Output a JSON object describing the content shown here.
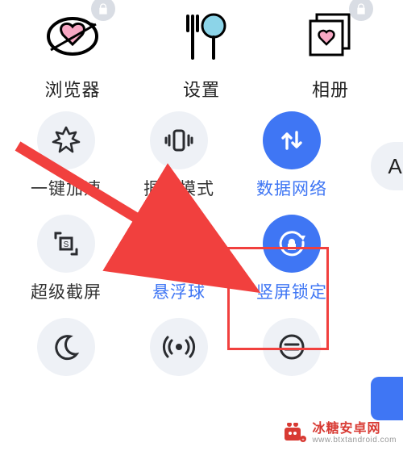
{
  "apps": [
    {
      "id": "browser",
      "label": "浏览器",
      "locked": true
    },
    {
      "id": "settings",
      "label": "设置",
      "locked": false
    },
    {
      "id": "gallery",
      "label": "相册",
      "locked": true
    }
  ],
  "quick_settings": [
    {
      "id": "boost",
      "label": "一键加速",
      "state": "off"
    },
    {
      "id": "vibrate",
      "label": "振动模式",
      "state": "off"
    },
    {
      "id": "data",
      "label": "数据网络",
      "state": "on"
    },
    {
      "id": "screenshot",
      "label": "超级截屏",
      "state": "off"
    },
    {
      "id": "floatball",
      "label": "悬浮球",
      "state": "on"
    },
    {
      "id": "rotationlock",
      "label": "竖屏锁定",
      "state": "on"
    },
    {
      "id": "nightmode",
      "label": "",
      "state": "off"
    },
    {
      "id": "hotspot",
      "label": "",
      "state": "off"
    },
    {
      "id": "more",
      "label": "",
      "state": "off"
    }
  ],
  "highlight_target": "rotationlock",
  "font_size_button": "A",
  "watermark": {
    "cn": "冰糖安卓网",
    "en": "www.btxtandroid.com"
  },
  "colors": {
    "accent": "#3f76f4",
    "tile_off": "#eef1f6",
    "annotation_red": "#f1403e",
    "lock_badge": "#d9dde4",
    "brand": "#d83a33"
  }
}
